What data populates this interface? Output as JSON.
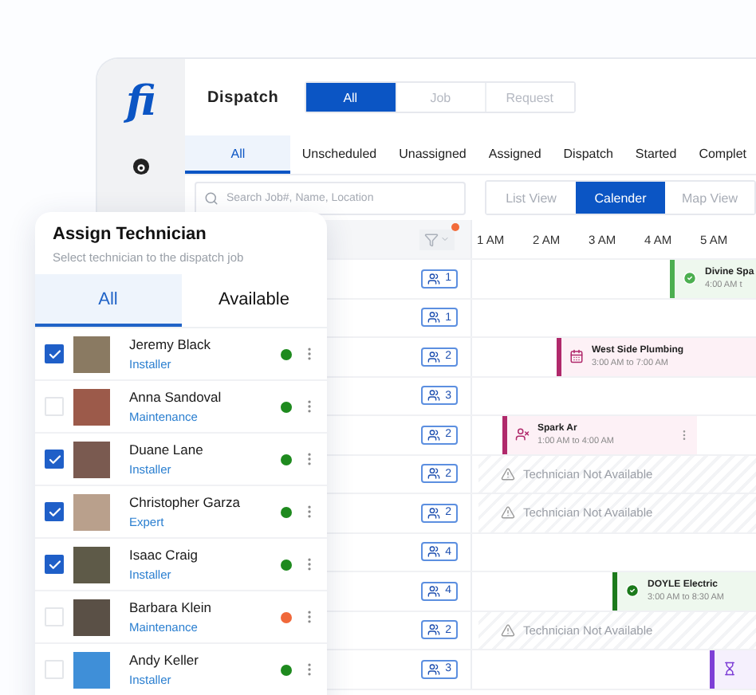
{
  "logo": "fi",
  "header": {
    "title": "Dispatch",
    "segments": [
      {
        "label": "All",
        "selected": true
      },
      {
        "label": "Job",
        "selected": false
      },
      {
        "label": "Request",
        "selected": false
      }
    ]
  },
  "status_tabs": [
    {
      "label": "All",
      "selected": true
    },
    {
      "label": "Unscheduled",
      "selected": false
    },
    {
      "label": "Unassigned",
      "selected": false
    },
    {
      "label": "Assigned",
      "selected": false
    },
    {
      "label": "Dispatch",
      "selected": false
    },
    {
      "label": "Started",
      "selected": false
    },
    {
      "label": "Complet",
      "selected": false
    }
  ],
  "search": {
    "placeholder": "Search Job#, Name, Location"
  },
  "views": [
    {
      "label": "List View",
      "selected": false
    },
    {
      "label": "Calender",
      "selected": true
    },
    {
      "label": "Map View",
      "selected": false
    }
  ],
  "filter": {
    "active": true
  },
  "hours": [
    "1 AM",
    "2 AM",
    "3 AM",
    "4 AM",
    "5 AM"
  ],
  "rows": [
    {
      "count": "1",
      "slot": {
        "kind": "completed",
        "color": "#4caf50",
        "title": "Divine Spa",
        "time": "4:00 AM t"
      }
    },
    {
      "count": "1"
    },
    {
      "count": "2",
      "slot": {
        "kind": "scheduled",
        "color": "#b0296b",
        "title": "West Side Plumbing",
        "time": "3:00 AM to 7:00 AM"
      }
    },
    {
      "count": "3"
    },
    {
      "count": "2",
      "slot": {
        "kind": "unassigned",
        "color": "#b0296b",
        "title": "Spark Ar",
        "time": "1:00 AM to 4:00 AM"
      }
    },
    {
      "count": "2",
      "slot": {
        "kind": "unavailable",
        "text": "Technician Not Available"
      }
    },
    {
      "count": "2",
      "slot": {
        "kind": "unavailable",
        "text": "Technician Not Available"
      }
    },
    {
      "count": "4"
    },
    {
      "count": "4",
      "slot": {
        "kind": "completed",
        "color": "#1b7a1b",
        "title": "DOYLE Electric",
        "time": "3:00 AM to 8:30 AM"
      }
    },
    {
      "count": "2",
      "slot": {
        "kind": "unavailable",
        "text": "Technician Not Available"
      }
    },
    {
      "count": "3",
      "slot": {
        "kind": "pending",
        "color": "#7e3fd6"
      }
    }
  ],
  "assign_panel": {
    "title": "Assign Technician",
    "subtitle": "Select technician to the dispatch job",
    "tabs": [
      {
        "label": "All",
        "selected": true
      },
      {
        "label": "Available",
        "selected": false
      }
    ],
    "technicians": [
      {
        "name": "Jeremy Black",
        "role": "Installer",
        "checked": true,
        "color": "#1e8a1e"
      },
      {
        "name": "Anna Sandoval",
        "role": "Maintenance",
        "checked": false,
        "color": "#1e8a1e"
      },
      {
        "name": "Duane Lane",
        "role": "Installer",
        "checked": true,
        "color": "#1e8a1e"
      },
      {
        "name": "Christopher Garza",
        "role": "Expert",
        "checked": true,
        "color": "#1e8a1e"
      },
      {
        "name": "Isaac Craig",
        "role": "Installer",
        "checked": true,
        "color": "#1e8a1e"
      },
      {
        "name": "Barbara Klein",
        "role": "Maintenance",
        "checked": false,
        "color": "#f0683a"
      },
      {
        "name": "Andy Keller",
        "role": "Installer",
        "checked": false,
        "color": "#1e8a1e"
      }
    ]
  }
}
